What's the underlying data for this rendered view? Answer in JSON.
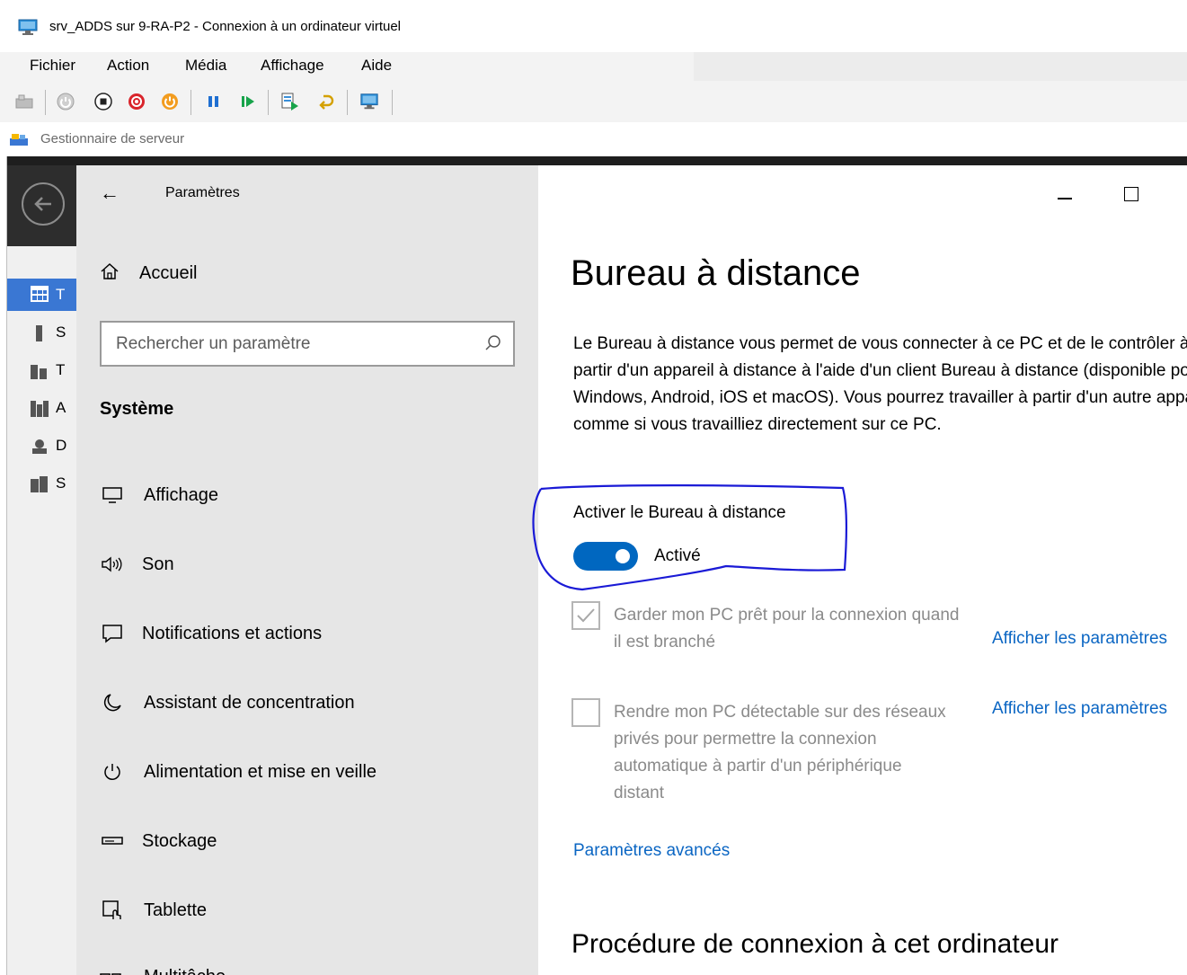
{
  "vm": {
    "title": "srv_ADDS sur 9-RA-P2 - Connexion à un ordinateur virtuel",
    "menu": [
      "Fichier",
      "Action",
      "Média",
      "Affichage",
      "Aide"
    ],
    "toolbar_icons": [
      "ctrl-alt-del-icon",
      "start-icon",
      "turnoff-icon",
      "shutdown-icon",
      "save-icon",
      "pause-icon",
      "resume-icon",
      "checkpoint-icon",
      "revert-icon",
      "enhanced-session-icon"
    ]
  },
  "server_manager": {
    "title": "Gestionnaire de serveur",
    "side_items": [
      "T",
      "S",
      "T",
      "A",
      "D",
      "S"
    ]
  },
  "settings": {
    "app_title": "Paramètres",
    "home_label": "Accueil",
    "search_placeholder": "Rechercher un paramètre",
    "section_title": "Système",
    "nav_items": [
      {
        "label": "Affichage",
        "icon": "display-icon"
      },
      {
        "label": "Son",
        "icon": "sound-icon"
      },
      {
        "label": "Notifications et actions",
        "icon": "notifications-icon"
      },
      {
        "label": "Assistant de concentration",
        "icon": "focus-assist-icon"
      },
      {
        "label": "Alimentation et mise en veille",
        "icon": "power-icon"
      },
      {
        "label": "Stockage",
        "icon": "storage-icon"
      },
      {
        "label": "Tablette",
        "icon": "tablet-icon"
      }
    ],
    "nav_cut_label": "Multitâche"
  },
  "remote_desktop": {
    "heading": "Bureau à distance",
    "description": "Le Bureau à distance vous permet de vous connecter à ce PC et de le contrôler à partir d'un appareil à distance à l'aide d'un client Bureau à distance (disponible pour Windows, Android, iOS et macOS). Vous pourrez travailler à partir d'un autre appareil comme si vous travailliez directement sur ce PC.",
    "toggle_label": "Activer le Bureau à distance",
    "toggle_state": "Activé",
    "toggle_on": true,
    "option1": {
      "text": "Garder mon PC prêt pour la connexion quand il est branché",
      "checked": true,
      "link": "Afficher les paramètres"
    },
    "option2": {
      "text": "Rendre mon PC détectable sur des réseaux privés pour permettre la connexion automatique à partir d'un périphérique distant",
      "checked": false,
      "link": "Afficher les paramètres"
    },
    "advanced_link": "Paramètres avancés",
    "procedure_heading": "Procédure de connexion à cet ordinateur"
  },
  "colors": {
    "accent": "#0067c0",
    "link": "#0b66c3",
    "annotation": "#1a1ad6",
    "nav_bg": "#e6e6e6"
  }
}
